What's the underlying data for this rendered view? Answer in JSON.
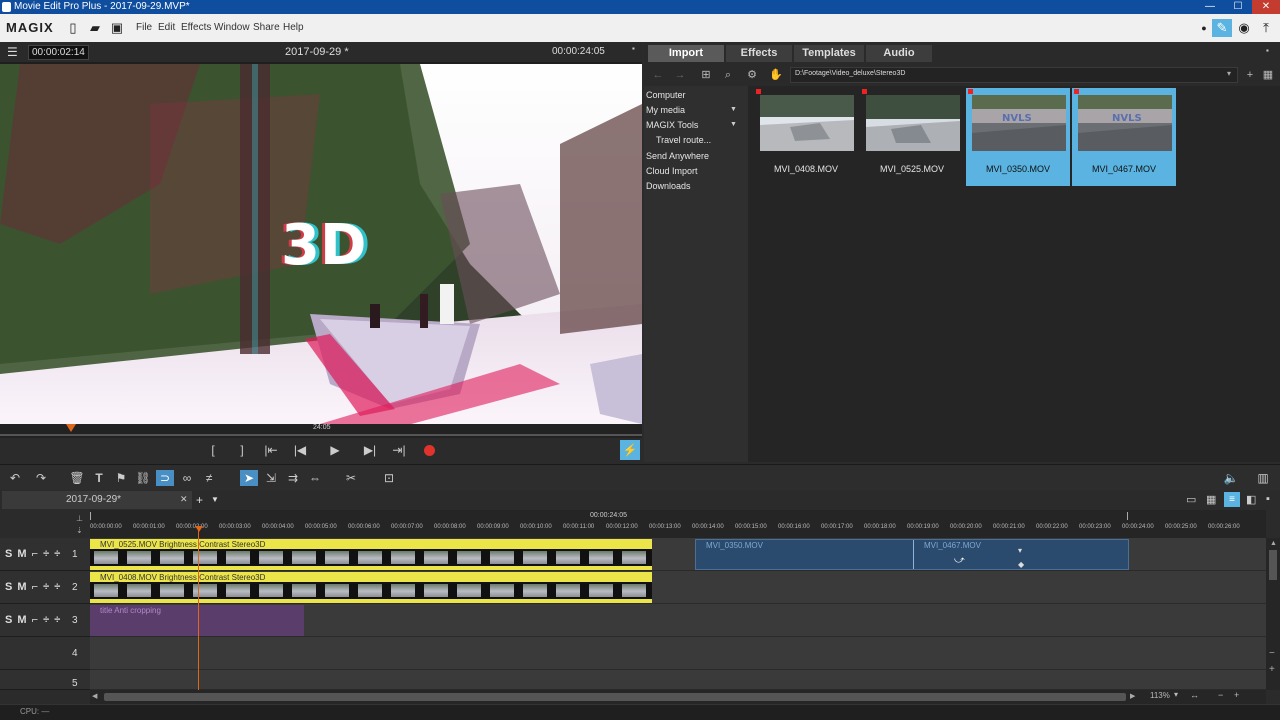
{
  "titlebar": {
    "title": "Movie Edit Pro Plus - 2017-09-29.MVP*",
    "minimize": "—",
    "maximize": "☐",
    "close": "✕"
  },
  "menubar": {
    "logo": "MAGIX",
    "menus": [
      "File",
      "Edit",
      "Effects",
      "Window",
      "Share",
      "Help"
    ],
    "icons": [
      "new-icon",
      "open-icon",
      "save-icon",
      "lamp-icon",
      "app-icon",
      "disc-icon",
      "export-icon"
    ]
  },
  "monitor": {
    "menu_icon": "☰",
    "current_time": "00:00:02:14",
    "title": "2017-09-29 *",
    "total_time": "00:00:24:05",
    "overlay_text": "3D",
    "scrub_label": "24:05",
    "transport": [
      "[",
      "]",
      "|⇤",
      "|◀",
      "▶",
      "▶|",
      "⇥|"
    ]
  },
  "browser": {
    "tabs": [
      "Import",
      "Effects",
      "Templates",
      "Audio"
    ],
    "path": "D:\\Footage\\Video_deluxe\\Stereo3D",
    "nav": [
      "Computer",
      "My media",
      "MAGIX Tools",
      "Travel route...",
      "Send Anywhere",
      "Cloud Import",
      "Downloads"
    ],
    "files": [
      {
        "name": "MVI_0408.MOV",
        "selected": false
      },
      {
        "name": "MVI_0525.MOV",
        "selected": false
      },
      {
        "name": "MVI_0350.MOV",
        "selected": true
      },
      {
        "name": "MVI_0467.MOV",
        "selected": true
      }
    ]
  },
  "timeline": {
    "project_tab": "2017-09-29*",
    "ruler_total": "00:00:24:05",
    "ruler_ticks": [
      "00:00:00:00",
      "00:00:01:00",
      "00:00:02:00",
      "00:00:03:00",
      "00:00:04:00",
      "00:00:05:00",
      "00:00:06:00",
      "00:00:07:00",
      "00:00:08:00",
      "00:00:09:00",
      "00:00:10:00",
      "00:00:11:00",
      "00:00:12:00",
      "00:00:13:00",
      "00:00:14:00",
      "00:00:15:00",
      "00:00:16:00",
      "00:00:17:00",
      "00:00:18:00",
      "00:00:19:00",
      "00:00:20:00",
      "00:00:21:00",
      "00:00:22:00",
      "00:00:23:00",
      "00:00:24:00",
      "00:00:25:00",
      "00:00:26:00"
    ],
    "tracks": [
      "1",
      "2",
      "3",
      "4",
      "5"
    ],
    "track_controls": "S M",
    "clips": {
      "t1_a": "MVI_0525.MOV   Brightness  Contrast  Stereo3D",
      "t1_b": "MVI_0350.MOV",
      "t1_c": "MVI_0467.MOV",
      "t2_a": "MVI_0408.MOV   Brightness  Contrast  Stereo3D",
      "t3_a": "title   Anti cropping"
    },
    "zoom": "113%"
  },
  "status": {
    "cpu": "CPU: —"
  },
  "colors": {
    "accent": "#5ab3e0",
    "titlebar": "#0f4d9e",
    "clip_yellow": "#ece54a",
    "clip_purple": "#5a3d6b",
    "record": "#e0332c"
  }
}
